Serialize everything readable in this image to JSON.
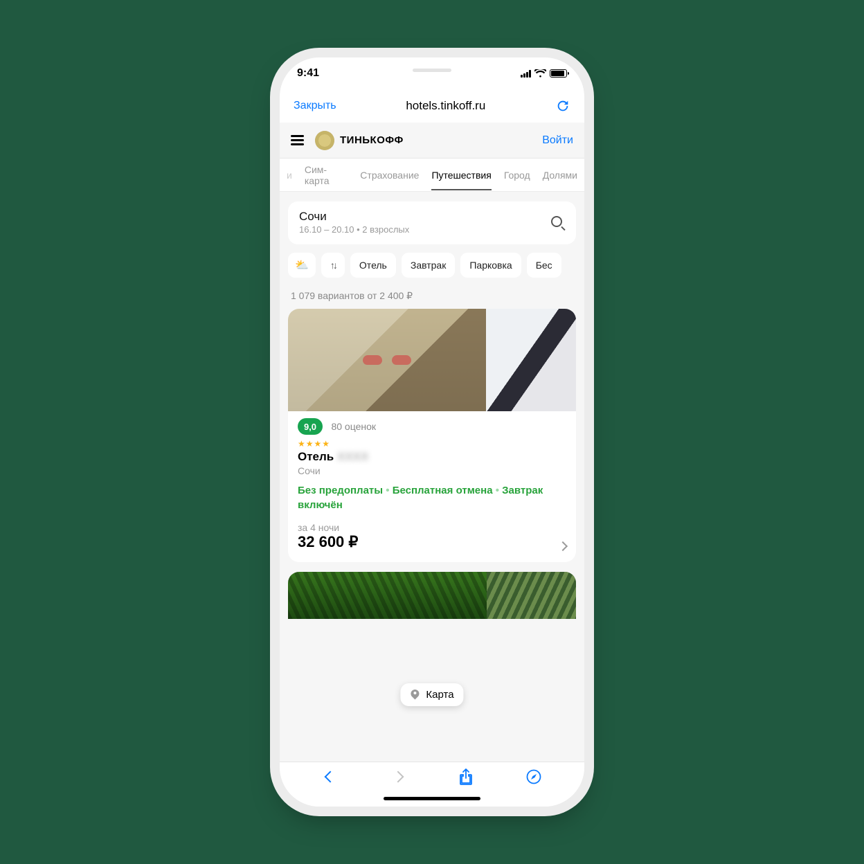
{
  "status": {
    "time": "9:41"
  },
  "safari": {
    "close": "Закрыть",
    "url": "hotels.tinkoff.ru"
  },
  "appbar": {
    "brand": "ТИНЬКОФФ",
    "login": "Войти"
  },
  "cats": [
    "и",
    "Сим-карта",
    "Страхование",
    "Путешествия",
    "Город",
    "Долями"
  ],
  "cats_active_index": 3,
  "search": {
    "city": "Сочи",
    "sub": "16.10 – 20.10 • 2 взрослых"
  },
  "chips": [
    "Отель",
    "Завтрак",
    "Парковка",
    "Бес"
  ],
  "chip_sun_emoji": "⛅",
  "summary": "1 079 вариантов от 2 400 ₽",
  "hotel": {
    "rating": "9,0",
    "reviews": "80 оценок",
    "stars": "★★★★",
    "name": "Отель",
    "name_blur": "XXXX",
    "city": "Сочи",
    "perk1": "Без предоплаты",
    "perk2": "Бесплатная отмена",
    "perk3": "Завтрак включён",
    "nights": "за 4 ночи",
    "price": "32 600 ₽"
  },
  "map_fab": "Карта"
}
